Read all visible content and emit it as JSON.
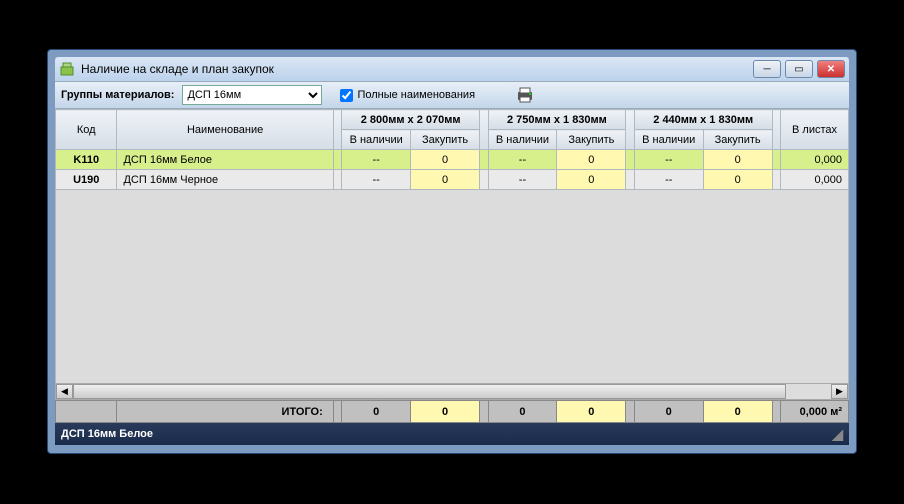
{
  "window": {
    "title": "Наличие на складе и план закупок"
  },
  "toolbar": {
    "groups_label": "Группы материалов:",
    "groups_value": "ДСП 16мм",
    "full_names_label": "Полные наименования"
  },
  "headers": {
    "code": "Код",
    "name": "Наименование",
    "sizes": [
      "2 800мм х 2 070мм",
      "2 750мм х 1 830мм",
      "2 440мм х 1 830мм"
    ],
    "stock": "В наличии",
    "buy": "Закупить",
    "sheets": "В листах"
  },
  "rows": [
    {
      "code": "K110",
      "name": "ДСП 16мм Белое",
      "cells": [
        "--",
        "0",
        "--",
        "0",
        "--",
        "0"
      ],
      "sheets": "0,000"
    },
    {
      "code": "U190",
      "name": "ДСП 16мм Черное",
      "cells": [
        "--",
        "0",
        "--",
        "0",
        "--",
        "0"
      ],
      "sheets": "0,000"
    }
  ],
  "totals": {
    "label": "ИТОГО:",
    "values": [
      "0",
      "0",
      "0",
      "0",
      "0",
      "0"
    ],
    "sheets": "0,000 м²"
  },
  "status": {
    "text": "ДСП 16мм Белое"
  }
}
